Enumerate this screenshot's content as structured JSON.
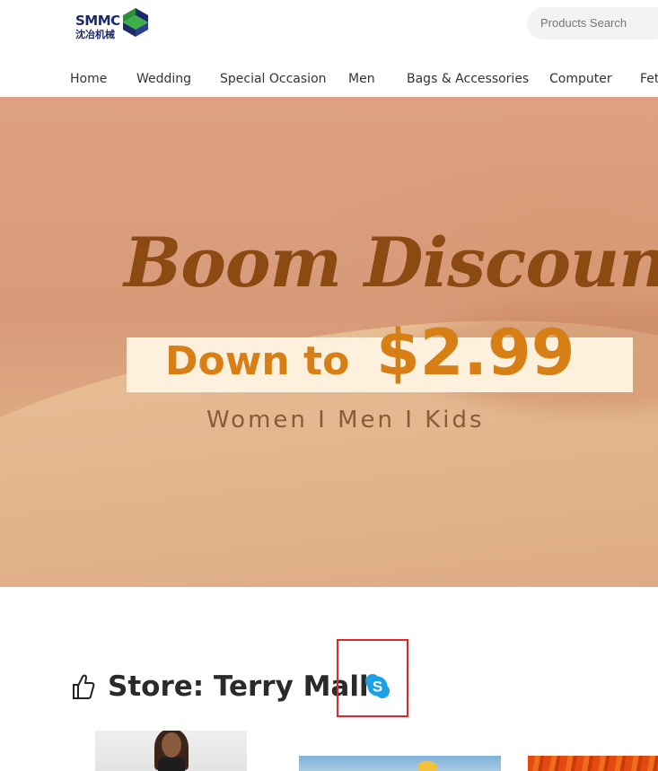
{
  "header": {
    "logo": {
      "name": "SMMC",
      "subtitle": "沈冶机械"
    },
    "search": {
      "placeholder": "Products Search"
    }
  },
  "nav": {
    "items": [
      {
        "label": "Home"
      },
      {
        "label": "Wedding"
      },
      {
        "label": "Special Occasion"
      },
      {
        "label": "Men"
      },
      {
        "label": "Bags & Accessories"
      },
      {
        "label": "Computer"
      },
      {
        "label": "Fet"
      }
    ]
  },
  "banner": {
    "headline": "Boom Discount",
    "promo_prefix": "Down to",
    "promo_price": "$2.99",
    "categories": "Women  I  Men  I  Kids"
  },
  "store": {
    "title": "Store: Terry Mall",
    "contact_icon": "skype-icon"
  },
  "colors": {
    "banner_text": "#8a4a12",
    "promo_orange": "#d77f14",
    "highlight_red": "#e3262b",
    "skype_blue": "#1aa1e6"
  }
}
